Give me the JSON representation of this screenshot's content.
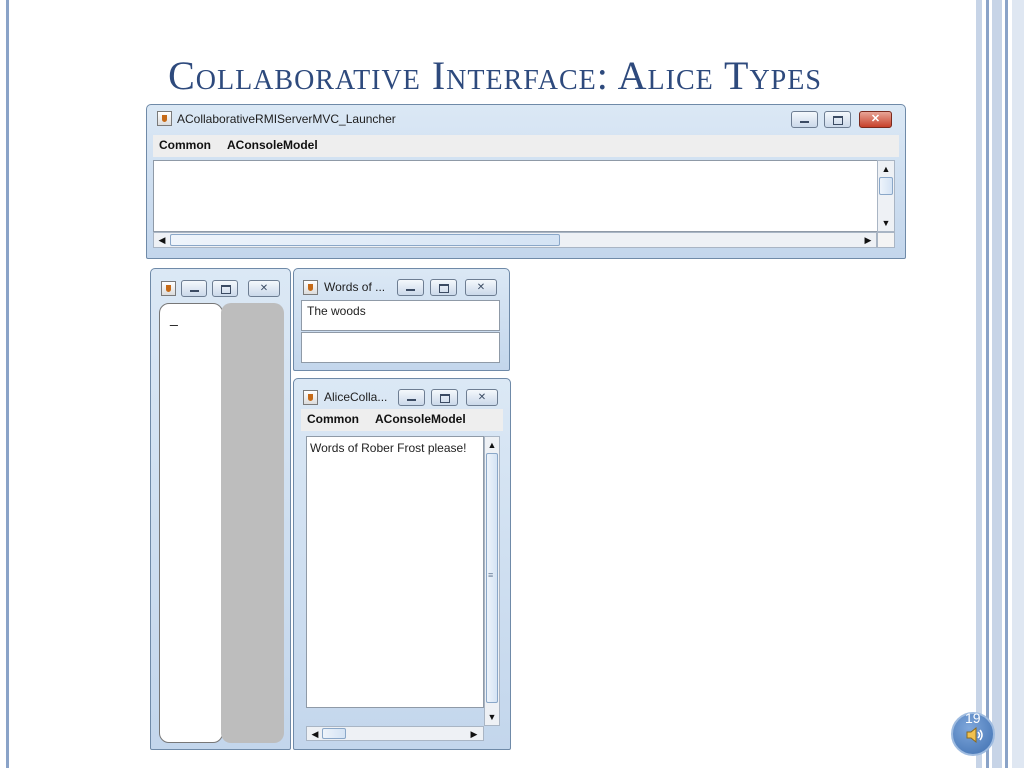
{
  "slide": {
    "title": "Collaborative Interface: Alice Types",
    "page_number": "19"
  },
  "launcher": {
    "title": "ACollaborativeRMIServerMVC_Launcher",
    "menu": [
      "Common",
      "AConsoleModel"
    ]
  },
  "small_window": {
    "text_cursor": "_"
  },
  "words_window": {
    "title": "Words of ...",
    "output_text": "The woods",
    "input_value": ""
  },
  "alice_window": {
    "title": "AliceColla...",
    "menu": [
      "Common",
      "AConsoleModel"
    ],
    "console_text": "Words of Rober Frost please!"
  },
  "colors": {
    "title": "#2e4a7d",
    "window_frame": "#c3d6ec",
    "close_button": "#c7402a",
    "speaker": "#3e6fb0"
  },
  "icons": [
    "java-app-icon",
    "minimize-icon",
    "maximize-icon",
    "close-icon",
    "speaker-icon"
  ]
}
